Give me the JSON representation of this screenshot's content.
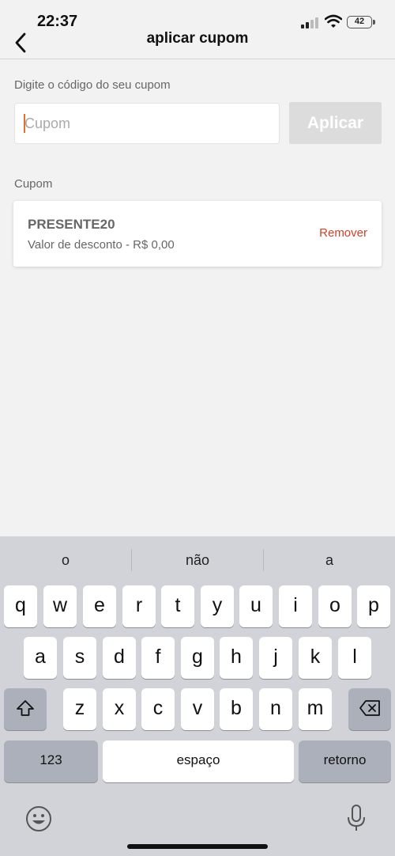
{
  "status_bar": {
    "time": "22:37",
    "battery_level": "42"
  },
  "nav": {
    "title": "aplicar cupom"
  },
  "form": {
    "code_label": "Digite o código do seu cupom",
    "input_placeholder": "Cupom",
    "input_value": "",
    "apply_label": "Aplicar"
  },
  "coupon_section": {
    "label": "Cupom",
    "code": "PRESENTE20",
    "discount_text": "Valor de desconto - R$ 0,00",
    "remove_label": "Remover"
  },
  "keyboard": {
    "suggestions": [
      "o",
      "não",
      "a"
    ],
    "row1": [
      "q",
      "w",
      "e",
      "r",
      "t",
      "y",
      "u",
      "i",
      "o",
      "p"
    ],
    "row2": [
      "a",
      "s",
      "d",
      "f",
      "g",
      "h",
      "j",
      "k",
      "l"
    ],
    "row3": [
      "z",
      "x",
      "c",
      "v",
      "b",
      "n",
      "m"
    ],
    "numbers_label": "123",
    "space_label": "espaço",
    "return_label": "retorno"
  },
  "colors": {
    "accent": "#d0402a",
    "caret": "#e0742a",
    "apply_disabled": "#dcdcdc",
    "keyboard_bg": "#d1d3d9"
  }
}
